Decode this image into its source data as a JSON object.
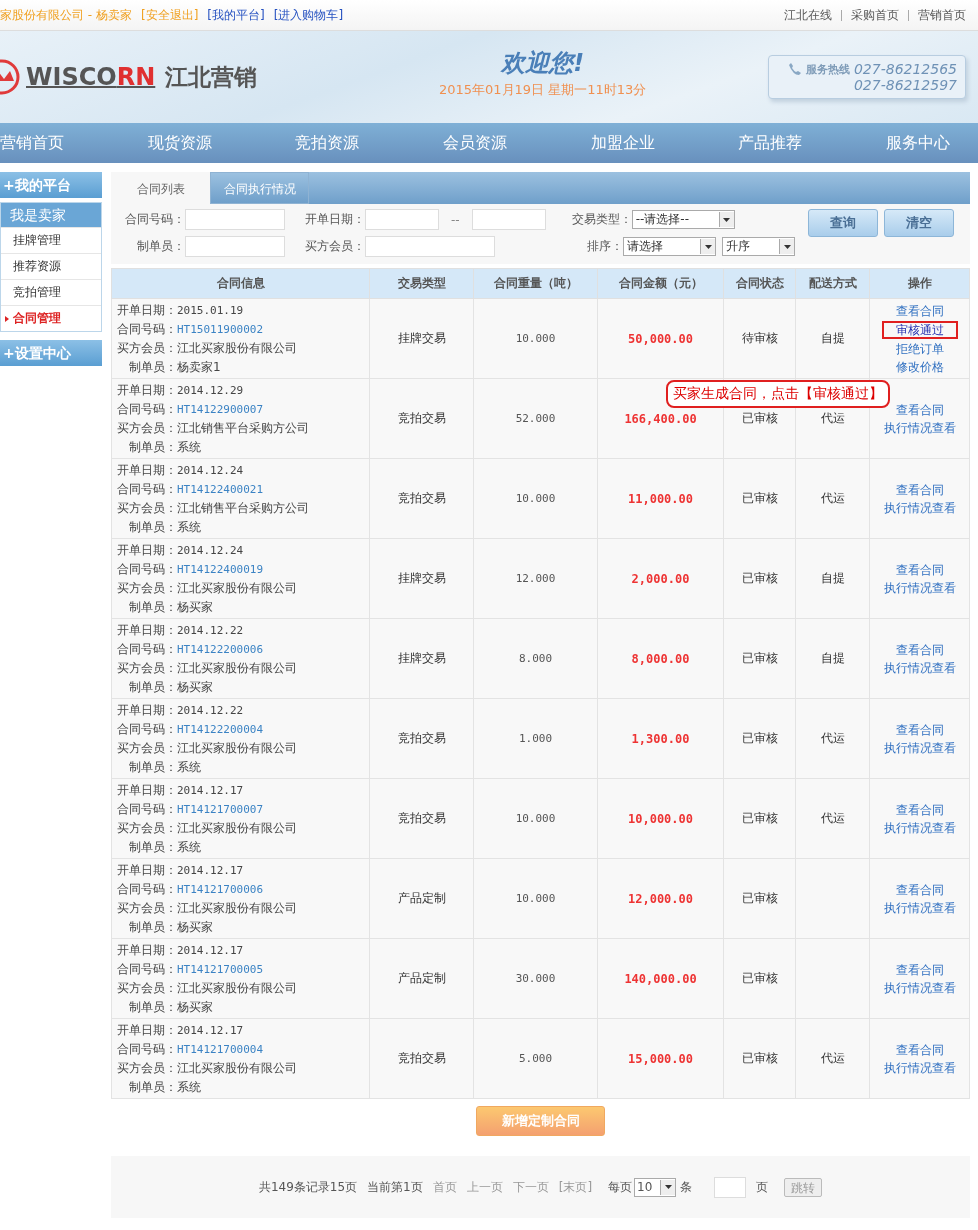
{
  "top_bar": {
    "user": "家股份有限公司 - 杨卖家",
    "links": [
      "[安全退出]",
      "[我的平台]",
      "[进入购物车]"
    ],
    "right_links": [
      "江北在线",
      "采购首页",
      "营销首页"
    ]
  },
  "header": {
    "logo_main": "WISCO",
    "logo_accent": "RN",
    "logo_cn": "江北营销",
    "welcome": "欢迎您!",
    "datetime": "2015年01月19日 星期一11时13分",
    "hotline_label": "服务热线",
    "phones": [
      "027-86212565",
      "027-86212597"
    ]
  },
  "nav": [
    "营销首页",
    "现货资源",
    "竞拍资源",
    "会员资源",
    "加盟企业",
    "产品推荐",
    "服务中心"
  ],
  "sidebar": {
    "sections": [
      {
        "title": "+我的平台",
        "group": "我是卖家",
        "items": [
          {
            "label": "挂牌管理",
            "selected": false
          },
          {
            "label": "推荐资源",
            "selected": false
          },
          {
            "label": "竞拍管理",
            "selected": false
          },
          {
            "label": "合同管理",
            "selected": true
          }
        ]
      },
      {
        "title": "+设置中心"
      }
    ]
  },
  "tabs": [
    {
      "label": "合同列表",
      "selected": true
    },
    {
      "label": "合同执行情况",
      "selected": false
    }
  ],
  "filters": {
    "contract_no": "合同号码：",
    "open_date": "开单日期：",
    "date_sep": "--",
    "trade_type": "交易类型：",
    "trade_type_value": "--请选择--",
    "maker": "制单员：",
    "buyer": "买方会员：",
    "sort": "排序：",
    "sort_value": "请选择",
    "order_value": "升序",
    "buttons": [
      "查询",
      "清空"
    ]
  },
  "table": {
    "columns": [
      "合同信息",
      "交易类型",
      "合同重量（吨）",
      "合同金额（元）",
      "合同状态",
      "配送方式",
      "操作"
    ],
    "rows": [
      {
        "info": [
          [
            "开单日期：",
            "2015.01.19"
          ],
          [
            "合同号码：",
            "HT15011900002"
          ],
          [
            "买方会员：",
            "江北买家股份有限公司"
          ],
          [
            "制单员：",
            "杨卖家1"
          ]
        ],
        "type": "挂牌交易",
        "weight": "10.000",
        "amount": "50,000.00",
        "status": "待审核",
        "delivery": "自提",
        "actions": [
          {
            "label": "查看合同",
            "highlighted": false
          },
          {
            "label": "审核通过",
            "highlighted": true
          },
          {
            "label": "拒绝订单",
            "highlighted": false
          },
          {
            "label": "修改价格",
            "highlighted": false
          }
        ]
      },
      {
        "info": [
          [
            "开单日期：",
            "2014.12.29"
          ],
          [
            "合同号码：",
            "HT14122900007"
          ],
          [
            "买方会员：",
            "江北销售平台采购方公司"
          ],
          [
            "制单员：",
            "系统"
          ]
        ],
        "type": "竞拍交易",
        "weight": "52.000",
        "amount": "166,400.00",
        "status": "已审核",
        "delivery": "代运",
        "actions": [
          {
            "label": "查看合同",
            "highlighted": false
          },
          {
            "label": "执行情况查看",
            "highlighted": false
          }
        ]
      },
      {
        "info": [
          [
            "开单日期：",
            "2014.12.24"
          ],
          [
            "合同号码：",
            "HT14122400021"
          ],
          [
            "买方会员：",
            "江北销售平台采购方公司"
          ],
          [
            "制单员：",
            "系统"
          ]
        ],
        "type": "竞拍交易",
        "weight": "10.000",
        "amount": "11,000.00",
        "status": "已审核",
        "delivery": "代运",
        "actions": [
          {
            "label": "查看合同",
            "highlighted": false
          },
          {
            "label": "执行情况查看",
            "highlighted": false
          }
        ]
      },
      {
        "info": [
          [
            "开单日期：",
            "2014.12.24"
          ],
          [
            "合同号码：",
            "HT14122400019"
          ],
          [
            "买方会员：",
            "江北买家股份有限公司"
          ],
          [
            "制单员：",
            "杨买家"
          ]
        ],
        "type": "挂牌交易",
        "weight": "12.000",
        "amount": "2,000.00",
        "status": "已审核",
        "delivery": "自提",
        "actions": [
          {
            "label": "查看合同",
            "highlighted": false
          },
          {
            "label": "执行情况查看",
            "highlighted": false
          }
        ]
      },
      {
        "info": [
          [
            "开单日期：",
            "2014.12.22"
          ],
          [
            "合同号码：",
            "HT14122200006"
          ],
          [
            "买方会员：",
            "江北买家股份有限公司"
          ],
          [
            "制单员：",
            "杨买家"
          ]
        ],
        "type": "挂牌交易",
        "weight": "8.000",
        "amount": "8,000.00",
        "status": "已审核",
        "delivery": "自提",
        "actions": [
          {
            "label": "查看合同",
            "highlighted": false
          },
          {
            "label": "执行情况查看",
            "highlighted": false
          }
        ]
      },
      {
        "info": [
          [
            "开单日期：",
            "2014.12.22"
          ],
          [
            "合同号码：",
            "HT14122200004"
          ],
          [
            "买方会员：",
            "江北买家股份有限公司"
          ],
          [
            "制单员：",
            "系统"
          ]
        ],
        "type": "竞拍交易",
        "weight": "1.000",
        "amount": "1,300.00",
        "status": "已审核",
        "delivery": "代运",
        "actions": [
          {
            "label": "查看合同",
            "highlighted": false
          },
          {
            "label": "执行情况查看",
            "highlighted": false
          }
        ]
      },
      {
        "info": [
          [
            "开单日期：",
            "2014.12.17"
          ],
          [
            "合同号码：",
            "HT14121700007"
          ],
          [
            "买方会员：",
            "江北买家股份有限公司"
          ],
          [
            "制单员：",
            "系统"
          ]
        ],
        "type": "竞拍交易",
        "weight": "10.000",
        "amount": "10,000.00",
        "status": "已审核",
        "delivery": "代运",
        "actions": [
          {
            "label": "查看合同",
            "highlighted": false
          },
          {
            "label": "执行情况查看",
            "highlighted": false
          }
        ]
      },
      {
        "info": [
          [
            "开单日期：",
            "2014.12.17"
          ],
          [
            "合同号码：",
            "HT14121700006"
          ],
          [
            "买方会员：",
            "江北买家股份有限公司"
          ],
          [
            "制单员：",
            "杨买家"
          ]
        ],
        "type": "产品定制",
        "weight": "10.000",
        "amount": "12,000.00",
        "status": "已审核",
        "actions": [
          {
            "label": "查看合同",
            "highlighted": false
          },
          {
            "label": "执行情况查看",
            "highlighted": false
          }
        ]
      },
      {
        "info": [
          [
            "开单日期：",
            "2014.12.17"
          ],
          [
            "合同号码：",
            "HT14121700005"
          ],
          [
            "买方会员：",
            "江北买家股份有限公司"
          ],
          [
            "制单员：",
            "杨买家"
          ]
        ],
        "type": "产品定制",
        "weight": "30.000",
        "amount": "140,000.00",
        "status": "已审核",
        "actions": [
          {
            "label": "查看合同",
            "highlighted": false
          },
          {
            "label": "执行情况查看",
            "highlighted": false
          }
        ]
      },
      {
        "info": [
          [
            "开单日期：",
            "2014.12.17"
          ],
          [
            "合同号码：",
            "HT14121700004"
          ],
          [
            "买方会员：",
            "江北买家股份有限公司"
          ],
          [
            "制单员：",
            "系统"
          ]
        ],
        "type": "竞拍交易",
        "weight": "5.000",
        "amount": "15,000.00",
        "status": "已审核",
        "delivery": "代运",
        "actions": [
          {
            "label": "查看合同",
            "highlighted": false
          },
          {
            "label": "执行情况查看",
            "highlighted": false
          }
        ]
      }
    ]
  },
  "callout": "买家生成合同，点击【审核通过】",
  "add_button": "新增定制合同",
  "pagination": {
    "summary": "共149条记录15页",
    "current": "当前第1页",
    "links": [
      "首页",
      "上一页",
      "下一页",
      "[末页]"
    ],
    "per_page": "每页",
    "per_page_value": "10",
    "unit": "条",
    "page_unit": "页",
    "go": "跳转"
  }
}
